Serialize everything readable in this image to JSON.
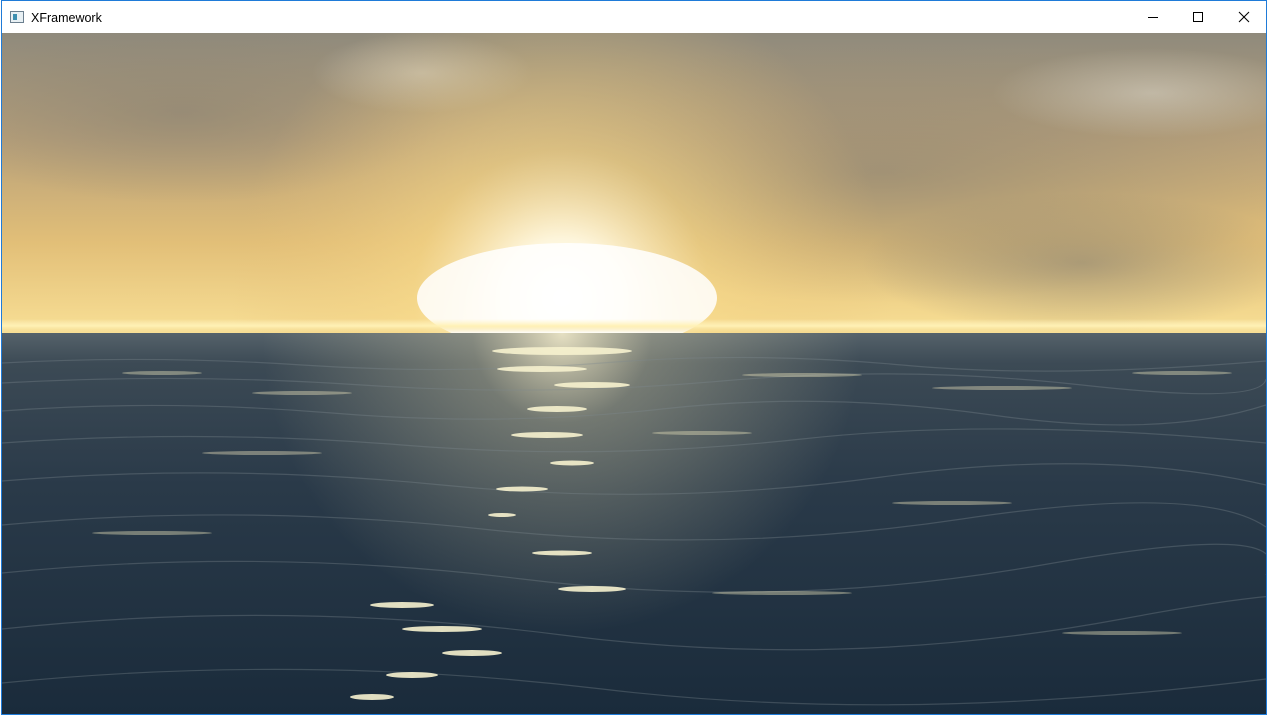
{
  "window": {
    "title": "XFramework",
    "icon": "app-window-icon",
    "controls": [
      "minimize-icon",
      "maximize-icon",
      "close-icon"
    ]
  },
  "scene": {
    "description_colors": {
      "sky_top": "#8e8672",
      "sky_glow": "#f6d98a",
      "sun": "#fffbe9",
      "horizon": "#fff1b8",
      "sea_far": "#3e4b55",
      "sea_near": "#1c2d3d",
      "sparkle": "#f4f0c8"
    }
  }
}
